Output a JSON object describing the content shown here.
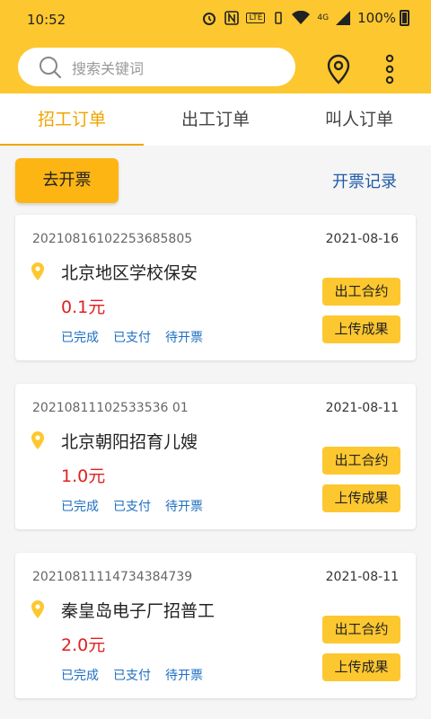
{
  "status_bar": {
    "time": "10:52",
    "network_4g": "4G",
    "network_lte": "LTE",
    "battery": "100%"
  },
  "search": {
    "placeholder": "搜索关键词"
  },
  "tabs": [
    {
      "label": "招工订单",
      "active": true
    },
    {
      "label": "出工订单",
      "active": false
    },
    {
      "label": "叫人订单",
      "active": false
    }
  ],
  "actions": {
    "invoice_button": "去开票",
    "invoice_record": "开票记录"
  },
  "orders": [
    {
      "order_no": "20210816102253685805",
      "date": "2021-08-16",
      "title": "北京地区学校保安",
      "price": "0.1元",
      "statuses": [
        "已完成",
        "已支付",
        "待开票"
      ],
      "contract_button": "出工合约",
      "upload_button": "上传成果"
    },
    {
      "order_no": "20210811102533536 01",
      "date": "2021-08-11",
      "title": "北京朝阳招育儿嫂",
      "price": "1.0元",
      "statuses": [
        "已完成",
        "已支付",
        "待开票"
      ],
      "contract_button": "出工合约",
      "upload_button": "上传成果"
    },
    {
      "order_no": "20210811114734384739",
      "date": "2021-08-11",
      "title": "秦皇岛电子厂招普工",
      "price": "2.0元",
      "statuses": [
        "已完成",
        "已支付",
        "待开票"
      ],
      "contract_button": "出工合约",
      "upload_button": "上传成果"
    }
  ],
  "colors": {
    "brand_yellow": "#fdc72f",
    "active_tab": "#f0a500",
    "price_red": "#e02020",
    "status_blue": "#1e6fc2",
    "link_blue": "#1e5aa8"
  },
  "icons": {
    "search": "search-icon",
    "location": "location-pin-icon",
    "more": "more-vertical-icon",
    "card_pin": "map-pin-icon"
  }
}
